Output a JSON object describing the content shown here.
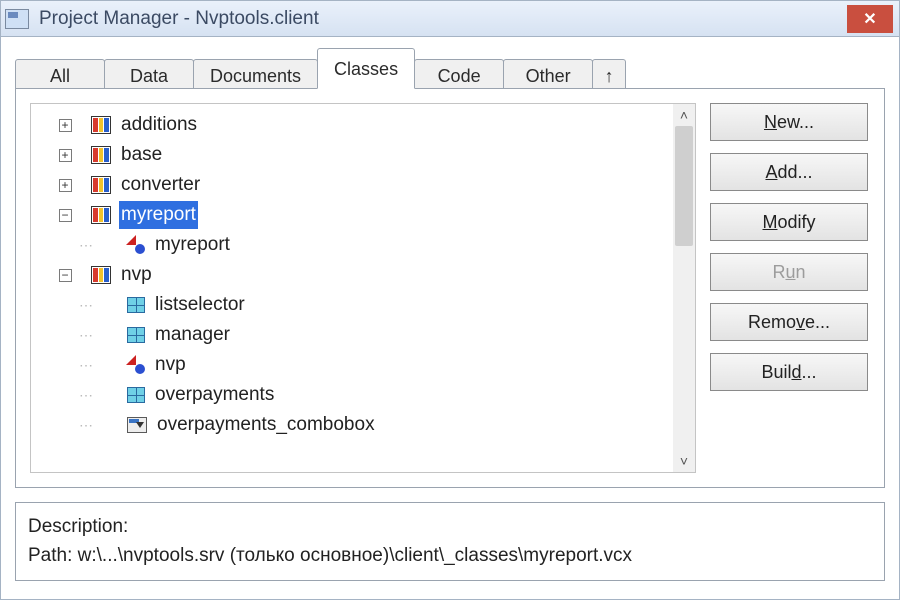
{
  "window": {
    "title": "Project Manager - Nvptools.client"
  },
  "tabs": {
    "items": [
      {
        "label": "All"
      },
      {
        "label": "Data"
      },
      {
        "label": "Documents"
      },
      {
        "label": "Classes",
        "active": true
      },
      {
        "label": "Code"
      },
      {
        "label": "Other"
      }
    ],
    "overflow_glyph": "↑"
  },
  "buttons": {
    "new": {
      "u": "N",
      "rest": "ew...",
      "enabled": true
    },
    "add": {
      "u": "A",
      "rest": "dd...",
      "enabled": true
    },
    "modify": {
      "u": "M",
      "rest": "odify",
      "enabled": true
    },
    "run": {
      "u_prefix": "R",
      "u": "u",
      "rest": "n",
      "enabled": false
    },
    "remove": {
      "prefix": "Remo",
      "u": "v",
      "rest": "e...",
      "enabled": true
    },
    "build": {
      "prefix": "Buil",
      "u": "d",
      "rest": "...",
      "enabled": true
    }
  },
  "tree": {
    "items": [
      {
        "level": 0,
        "pm": "+",
        "icon": "lib",
        "label": "additions"
      },
      {
        "level": 0,
        "pm": "+",
        "icon": "lib",
        "label": "base"
      },
      {
        "level": 0,
        "pm": "+",
        "icon": "lib",
        "label": "converter"
      },
      {
        "level": 0,
        "pm": "−",
        "icon": "lib",
        "label": "myreport",
        "selected": true
      },
      {
        "level": 1,
        "icon": "class",
        "label": "myreport"
      },
      {
        "level": 0,
        "pm": "−",
        "icon": "lib",
        "label": "nvp"
      },
      {
        "level": 1,
        "icon": "grid",
        "label": "listselector"
      },
      {
        "level": 1,
        "icon": "grid",
        "label": "manager"
      },
      {
        "level": 1,
        "icon": "class",
        "label": "nvp"
      },
      {
        "level": 1,
        "icon": "grid",
        "label": "overpayments"
      },
      {
        "level": 1,
        "icon": "combo",
        "label": "overpayments_combobox"
      }
    ]
  },
  "footer": {
    "desc_label": "Description:",
    "desc_value": "",
    "path_label": "Path:",
    "path_value": "w:\\...\\nvptools.srv (только основное)\\client\\_classes\\myreport.vcx"
  }
}
